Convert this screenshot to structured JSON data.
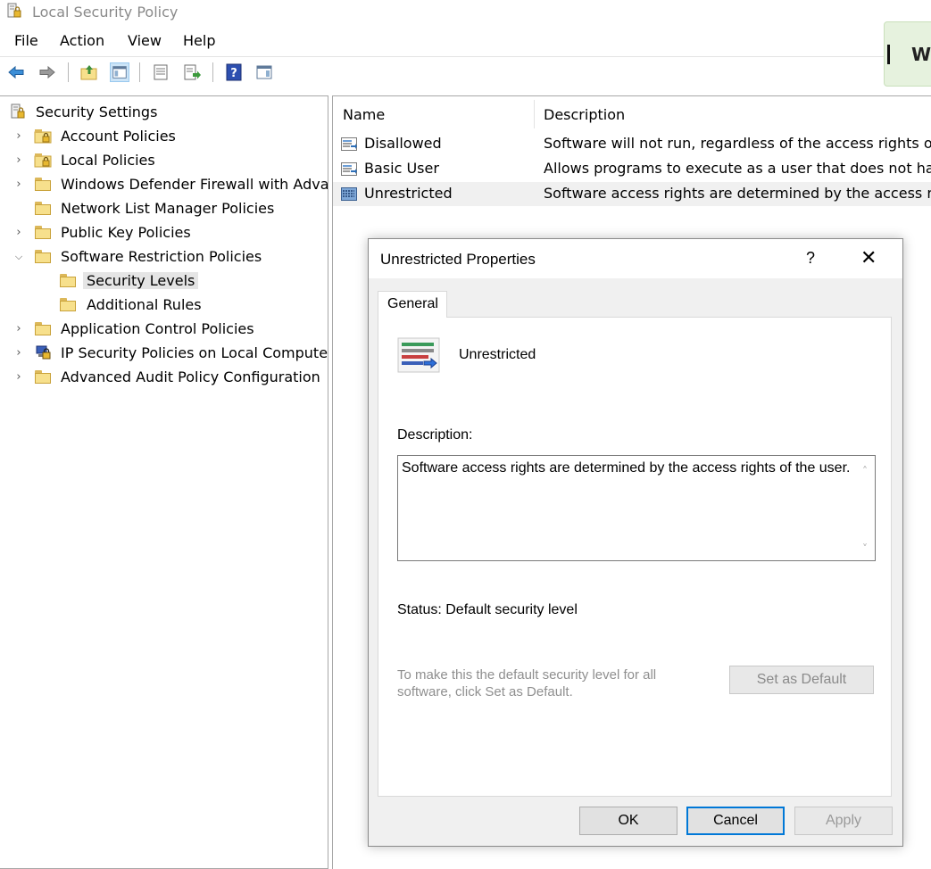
{
  "window": {
    "title": "Local Security Policy"
  },
  "menu": [
    "File",
    "Action",
    "View",
    "Help"
  ],
  "notification": {
    "text": "W"
  },
  "tree": {
    "items": [
      {
        "label": "Security Settings",
        "expander": "",
        "icon": "security-settings-icon"
      },
      {
        "label": "Account Policies",
        "expander": ">",
        "icon": "locked-folder-icon"
      },
      {
        "label": "Local Policies",
        "expander": ">",
        "icon": "locked-folder-icon"
      },
      {
        "label": "Windows Defender Firewall with Adva",
        "expander": ">",
        "icon": "folder-icon"
      },
      {
        "label": "Network List Manager Policies",
        "expander": "",
        "icon": "folder-icon"
      },
      {
        "label": "Public Key Policies",
        "expander": ">",
        "icon": "folder-icon"
      },
      {
        "label": "Software Restriction Policies",
        "expander": "v",
        "icon": "folder-icon"
      },
      {
        "label": "Security Levels",
        "expander": "",
        "icon": "folder-icon"
      },
      {
        "label": "Additional Rules",
        "expander": "",
        "icon": "folder-icon"
      },
      {
        "label": "Application Control Policies",
        "expander": ">",
        "icon": "folder-icon"
      },
      {
        "label": "IP Security Policies on Local Compute",
        "expander": ">",
        "icon": "ip-security-icon"
      },
      {
        "label": "Advanced Audit Policy Configuration",
        "expander": ">",
        "icon": "folder-icon"
      }
    ]
  },
  "list": {
    "columns": [
      "Name",
      "Description"
    ],
    "rows": [
      {
        "name": "Disallowed",
        "description": "Software will not run, regardless of the access rights of t"
      },
      {
        "name": "Basic User",
        "description": "Allows programs to execute as a user that does not hav"
      },
      {
        "name": "Unrestricted",
        "description": "Software access rights are determined by the access rig"
      }
    ]
  },
  "dialog": {
    "title": "Unrestricted Properties",
    "help": "?",
    "close": "✕",
    "tab": "General",
    "level_name": "Unrestricted",
    "description_label": "Description:",
    "description_text": "Software access rights are determined by the access rights of the user.",
    "status": "Status:  Default security level",
    "hint": "To make this the default security level for all software, click Set as Default.",
    "set_default": "Set as Default",
    "ok": "OK",
    "cancel": "Cancel",
    "apply": "Apply"
  },
  "colors": {
    "accent": "#0078d7",
    "notification_bg": "#e6f2de",
    "selection": "#e5e5e5"
  }
}
